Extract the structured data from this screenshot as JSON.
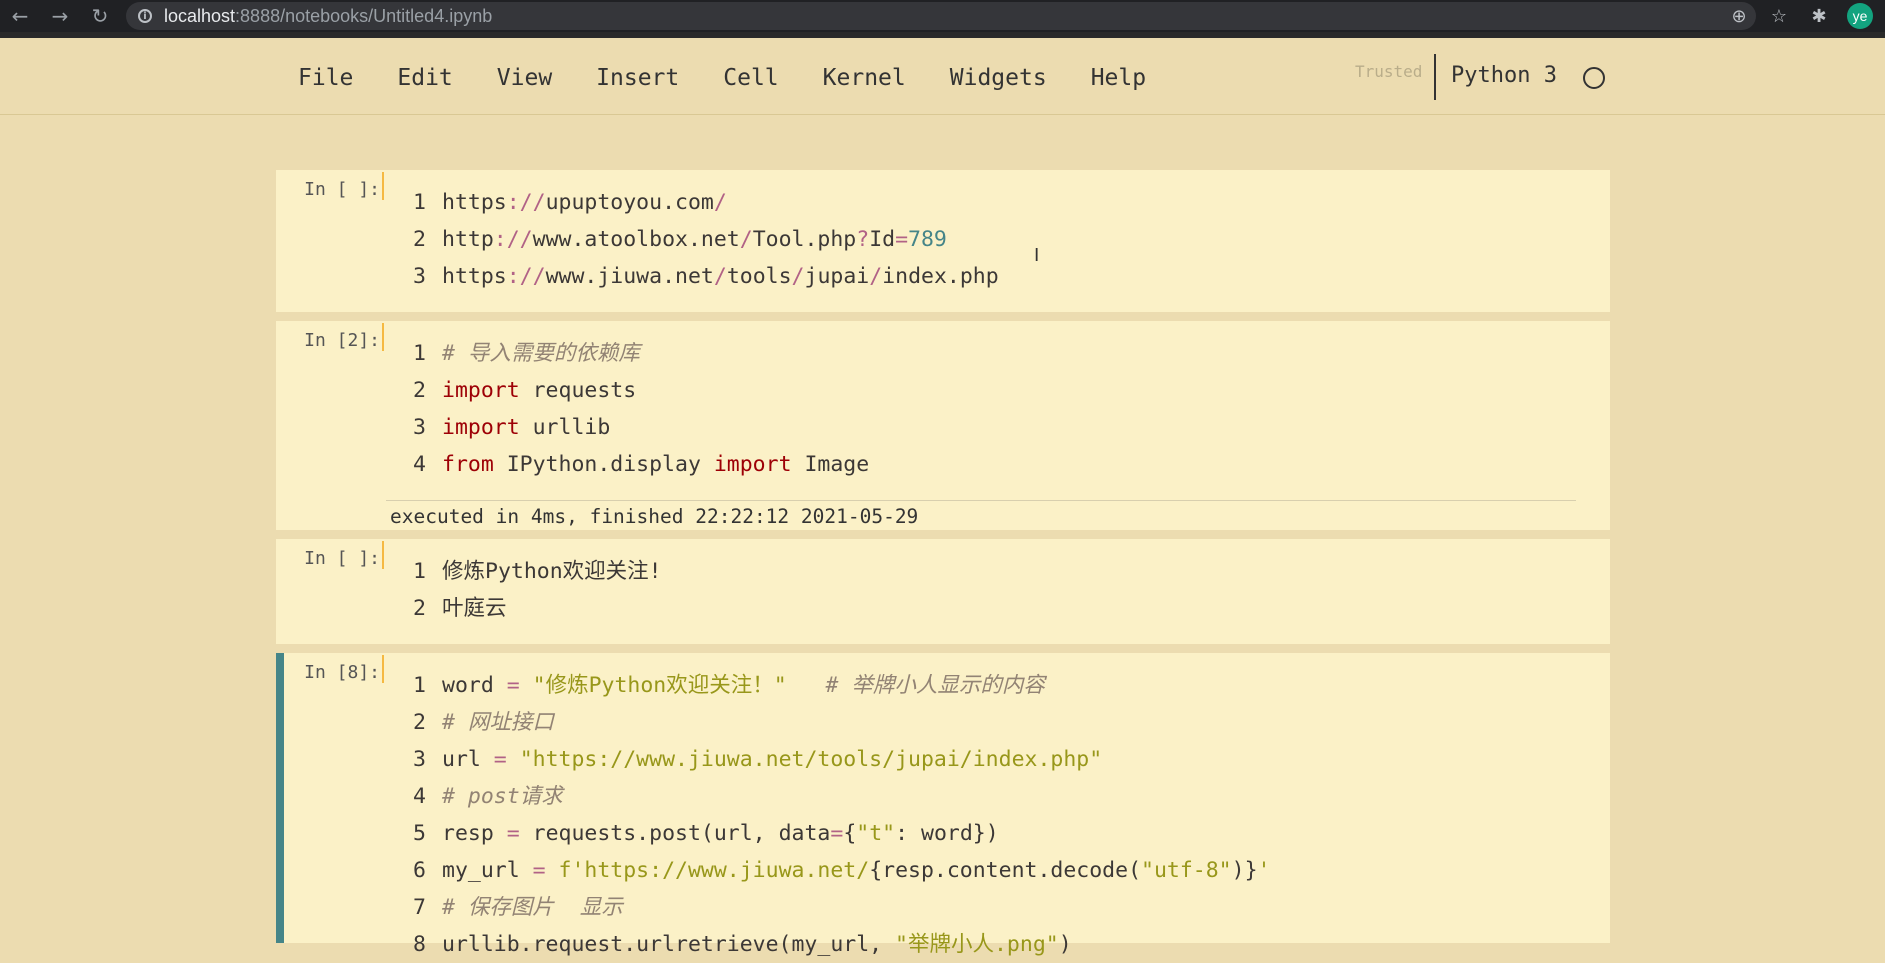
{
  "browser": {
    "url_host": "localhost",
    "url_rest": ":8888/notebooks/Untitled4.ipynb",
    "avatar": "ye"
  },
  "menu": {
    "items": [
      "File",
      "Edit",
      "View",
      "Insert",
      "Cell",
      "Kernel",
      "Widgets",
      "Help"
    ],
    "trusted": "Trusted",
    "kernel": "Python 3"
  },
  "cells": [
    {
      "prompt": "In [ ]:",
      "lines": [
        [
          [
            "",
            "https"
          ],
          [
            "op",
            "://"
          ],
          [
            "",
            "upuptoyou.com"
          ],
          [
            "op",
            "/"
          ]
        ],
        [
          [
            "",
            "http"
          ],
          [
            "op",
            "://"
          ],
          [
            "",
            "www.atoolbox.net"
          ],
          [
            "op",
            "/"
          ],
          [
            "",
            "Tool.php"
          ],
          [
            "op",
            "?"
          ],
          [
            "",
            "Id"
          ],
          [
            "op",
            "="
          ],
          [
            "num",
            "789"
          ]
        ],
        [
          [
            "",
            "https"
          ],
          [
            "op",
            "://"
          ],
          [
            "",
            "www.jiuwa.net"
          ],
          [
            "op",
            "/"
          ],
          [
            "",
            "tools"
          ],
          [
            "op",
            "/"
          ],
          [
            "",
            "jupai"
          ],
          [
            "op",
            "/"
          ],
          [
            "",
            "index.php"
          ]
        ]
      ]
    },
    {
      "prompt": "In [2]:",
      "lines": [
        [
          [
            "cm",
            "# 导入需要的依赖库"
          ]
        ],
        [
          [
            "kw",
            "import"
          ],
          [
            "",
            " requests"
          ]
        ],
        [
          [
            "kw",
            "import"
          ],
          [
            "",
            " urllib"
          ]
        ],
        [
          [
            "kw",
            "from"
          ],
          [
            "",
            " IPython.display "
          ],
          [
            "kw",
            "import"
          ],
          [
            "",
            " Image"
          ]
        ]
      ],
      "output": "executed in 4ms, finished 22:22:12 2021-05-29"
    },
    {
      "prompt": "In [ ]:",
      "lines": [
        [
          [
            "",
            "修炼Python欢迎关注!"
          ]
        ],
        [
          [
            "",
            "叶庭云"
          ]
        ]
      ]
    },
    {
      "prompt": "In [8]:",
      "lines": [
        [
          [
            "",
            "word "
          ],
          [
            "op",
            "="
          ],
          [
            "",
            " "
          ],
          [
            "str",
            "\"修炼Python欢迎关注！\""
          ],
          [
            "",
            "   "
          ],
          [
            "cm",
            "# 举牌小人显示的内容"
          ]
        ],
        [
          [
            "cm",
            "# 网址接口"
          ]
        ],
        [
          [
            "",
            "url "
          ],
          [
            "op",
            "="
          ],
          [
            "",
            " "
          ],
          [
            "str",
            "\"https://www.jiuwa.net/tools/jupai/index.php\""
          ]
        ],
        [
          [
            "cm",
            "# post请求"
          ]
        ],
        [
          [
            "",
            "resp "
          ],
          [
            "op",
            "="
          ],
          [
            "",
            " requests.post(url, data"
          ],
          [
            "op",
            "="
          ],
          [
            "",
            "{"
          ],
          [
            "str",
            "\"t\""
          ],
          [
            "",
            ": word})"
          ]
        ],
        [
          [
            "",
            "my_url "
          ],
          [
            "op",
            "="
          ],
          [
            "",
            " "
          ],
          [
            "str",
            "f'https://www.jiuwa.net/"
          ],
          [
            "",
            "{resp.content.decode("
          ],
          [
            "str",
            "\"utf-8\""
          ],
          [
            "",
            ")}"
          ],
          [
            "str",
            "'"
          ]
        ],
        [
          [
            "cm",
            "# 保存图片  显示"
          ]
        ],
        [
          [
            "",
            "urllib.request.urlretrieve(my_url, "
          ],
          [
            "str",
            "\"举牌小人.png\""
          ],
          [
            "",
            ")"
          ]
        ]
      ]
    }
  ]
}
